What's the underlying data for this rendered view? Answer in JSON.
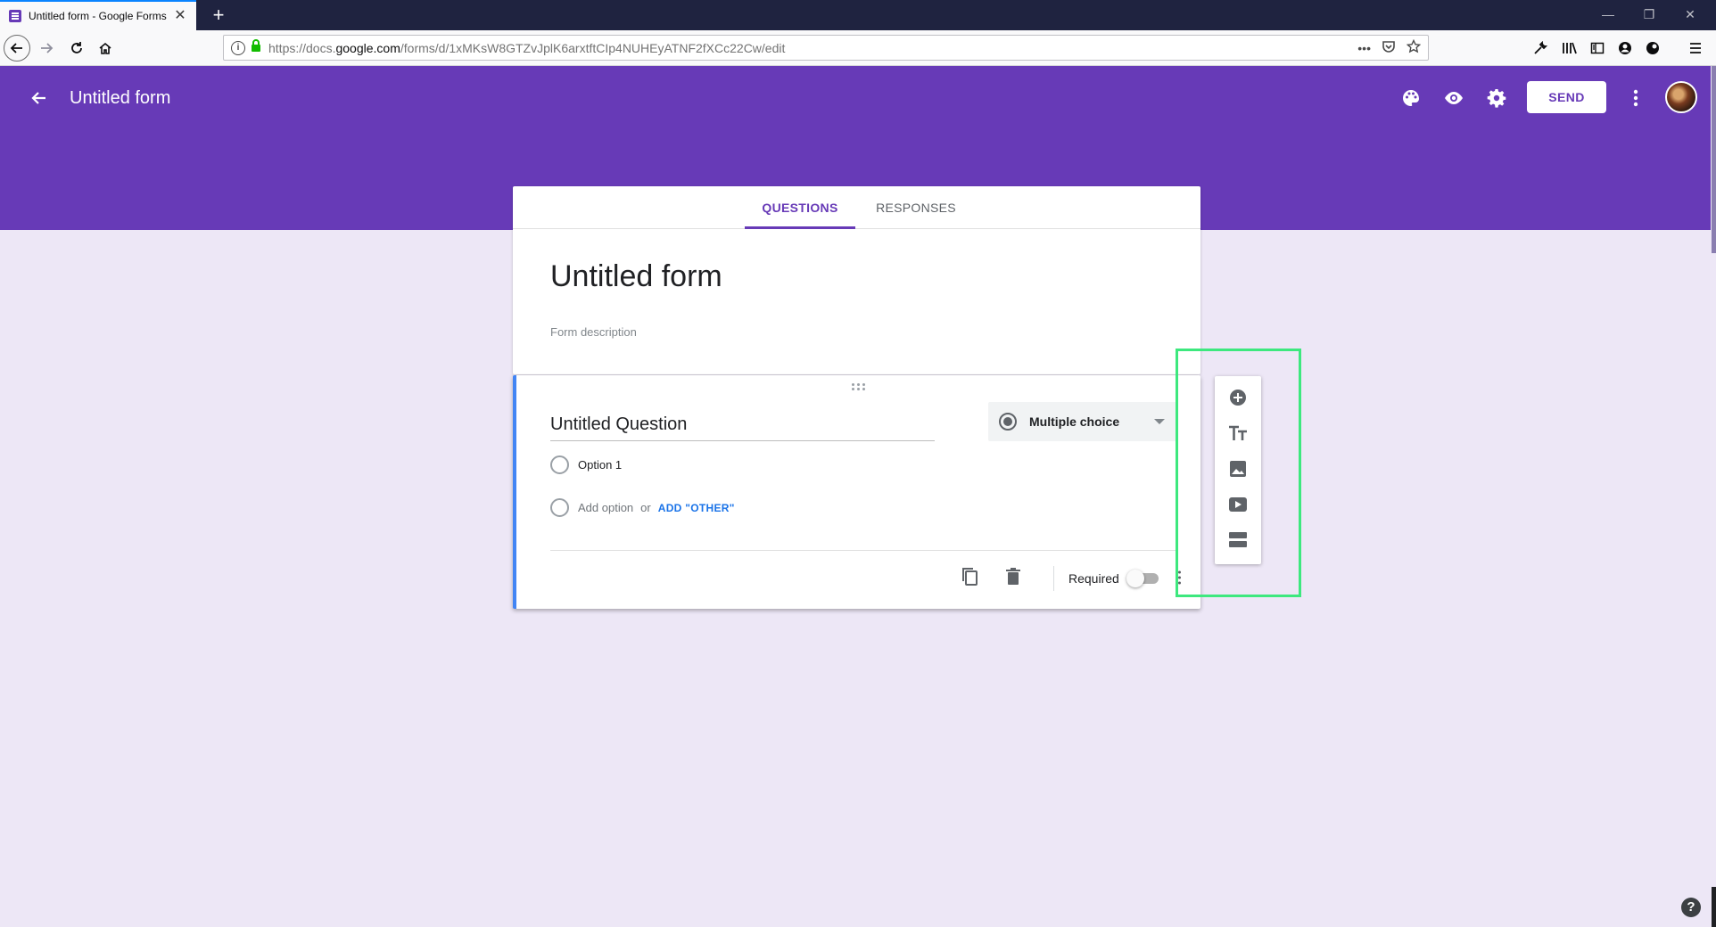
{
  "browser": {
    "tab_title": "Untitled form - Google Forms",
    "tab_close": "✕",
    "new_tab": "+",
    "url_prefix": "https://docs.",
    "url_host": "google.com",
    "url_path": "/forms/d/1xMKsW8GTZvJplK6arxtftCIp4NUHEyATNF2fXCc22Cw/edit",
    "page_actions": "•••",
    "window_controls": [
      "—",
      "❐",
      "✕"
    ],
    "icons": [
      "back-icon",
      "forward-icon",
      "reload-icon",
      "home-icon",
      "info-icon",
      "lock-icon",
      "pocket-icon",
      "bookmark-star-icon",
      "wrench-icon",
      "library-icon",
      "sidebar-icon",
      "account-icon",
      "extension-icon",
      "menu-icon"
    ]
  },
  "header": {
    "title": "Untitled form",
    "send_label": "SEND",
    "icons": [
      "palette-icon",
      "preview-eye-icon",
      "settings-gear-icon",
      "more-vert-icon",
      "avatar"
    ]
  },
  "form": {
    "tabs": [
      {
        "label": "QUESTIONS",
        "active": true
      },
      {
        "label": "RESPONSES",
        "active": false
      }
    ],
    "title": "Untitled form",
    "description_placeholder": "Form description"
  },
  "question": {
    "title": "Untitled Question",
    "type_label": "Multiple choice",
    "options": [
      "Option 1"
    ],
    "add_option": "Add option",
    "or_text": "or",
    "add_other": "ADD \"OTHER\"",
    "required_label": "Required",
    "required_on": false
  },
  "toolbar": {
    "items": [
      "add-question-icon",
      "add-title-icon",
      "add-image-icon",
      "add-video-icon",
      "add-section-icon"
    ]
  },
  "help": "?",
  "colors": {
    "accent": "#673ab7",
    "background": "#ede7f6",
    "highlight": "#3de87e",
    "link": "#1a73e8"
  }
}
